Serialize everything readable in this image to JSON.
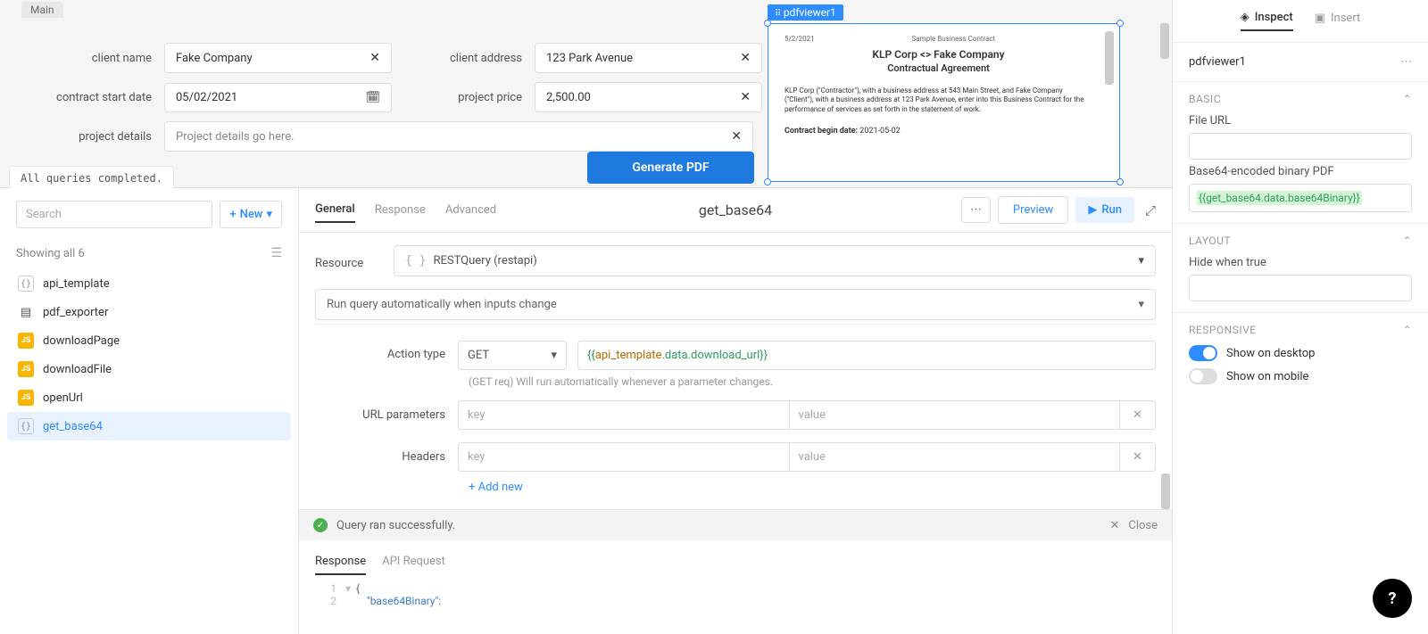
{
  "canvas": {
    "tab": "Main",
    "fields": {
      "client_name": {
        "label": "client name",
        "value": "Fake Company"
      },
      "client_address": {
        "label": "client address",
        "value": "123 Park Avenue"
      },
      "contract_start": {
        "label": "contract start date",
        "value": "05/02/2021"
      },
      "project_price": {
        "label": "project price",
        "value": "2,500.00"
      },
      "project_details": {
        "label": "project details",
        "placeholder": "Project details go here."
      }
    },
    "generate_btn": "Generate PDF",
    "pdf_component": {
      "name": "pdfviewer1",
      "doc": {
        "date": "5/2/2021",
        "header_small": "Sample Business Contract",
        "title": "KLP Corp <> Fake Company",
        "subtitle": "Contractual Agreement",
        "body": "KLP Corp (\"Contractor\"), with a business address at 543 Main Street, and Fake Company (\"Client\"), with a business address at 123 Park Avenue, enter into this Business Contract for the performance of services as set forth in the statement of work.",
        "begin_label": "Contract begin date:",
        "begin_value": "2021-05-02"
      }
    },
    "status_text": "All queries completed."
  },
  "left": {
    "search_placeholder": "Search",
    "new_btn": "New",
    "showing": "Showing all 6",
    "items": [
      {
        "icon": "rest",
        "label": "api_template"
      },
      {
        "icon": "doc",
        "label": "pdf_exporter"
      },
      {
        "icon": "js",
        "label": "downloadPage"
      },
      {
        "icon": "js",
        "label": "downloadFile"
      },
      {
        "icon": "js",
        "label": "openUrl"
      },
      {
        "icon": "rest",
        "label": "get_base64",
        "active": true
      }
    ]
  },
  "center": {
    "tabs": {
      "general": "General",
      "response": "Response",
      "advanced": "Advanced"
    },
    "title": "get_base64",
    "actions": {
      "preview": "Preview",
      "run": "Run"
    },
    "resource": {
      "label": "Resource",
      "value": "RESTQuery (restapi)"
    },
    "auto_run": "Run query automatically when inputs change",
    "action_type": {
      "label": "Action type",
      "method": "GET",
      "url_prefix": "{{",
      "url_obj": "api_template",
      "url_rest": ".data.download_url}}"
    },
    "hint": "(GET req) Will run automatically whenever a parameter changes.",
    "url_params": {
      "label": "URL parameters",
      "key_ph": "key",
      "val_ph": "value"
    },
    "headers": {
      "label": "Headers",
      "key_ph": "key",
      "val_ph": "value"
    },
    "add_new": "+ Add new",
    "result": {
      "msg": "Query ran successfully.",
      "close": "Close"
    },
    "result_tabs": {
      "response": "Response",
      "api": "API Request"
    },
    "json": {
      "l1": "{",
      "l2_key": "\"base64Binary\"",
      "l2_colon": ":"
    }
  },
  "right": {
    "tabs": {
      "inspect": "Inspect",
      "insert": "Insert"
    },
    "component_name": "pdfviewer1",
    "sections": {
      "basic": {
        "title": "BASIC",
        "file_url": "File URL",
        "b64_label": "Base64-encoded binary PDF",
        "b64_value": "{{get_base64.data.base64Binary}}"
      },
      "layout": {
        "title": "LAYOUT",
        "hide_label": "Hide when true"
      },
      "responsive": {
        "title": "RESPONSIVE",
        "desktop": "Show on desktop",
        "mobile": "Show on mobile"
      }
    }
  },
  "help": "?"
}
